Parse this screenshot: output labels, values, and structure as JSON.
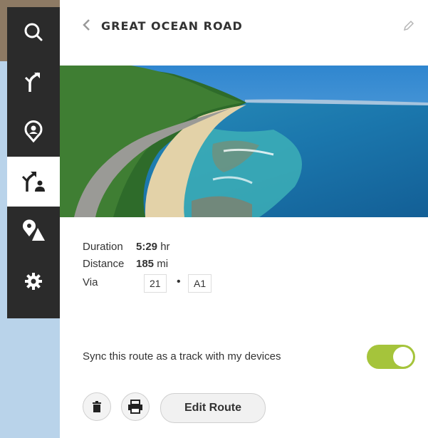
{
  "header": {
    "title": "GREAT OCEAN ROAD"
  },
  "sidebar": {
    "items": [
      {
        "icon": "search-icon"
      },
      {
        "icon": "route-plan-icon"
      },
      {
        "icon": "user-location-icon"
      },
      {
        "icon": "my-routes-icon",
        "active": true
      },
      {
        "icon": "poi-mountain-icon"
      },
      {
        "icon": "gear-icon"
      }
    ]
  },
  "details": {
    "duration_label": "Duration",
    "duration_value": "5:29",
    "duration_unit": "hr",
    "distance_label": "Distance",
    "distance_value": "185",
    "distance_unit": "mi",
    "via_label": "Via",
    "via_roads": [
      "21",
      "A1"
    ],
    "via_separator": "•"
  },
  "sync": {
    "label": "Sync this route as a track with my devices",
    "enabled": true
  },
  "actions": {
    "edit_route_label": "Edit Route"
  },
  "colors": {
    "accent": "#a5c43b",
    "sidebar": "#2b2b2b",
    "ocean": "#1a7fb0",
    "sky": "#4a9fd8"
  }
}
